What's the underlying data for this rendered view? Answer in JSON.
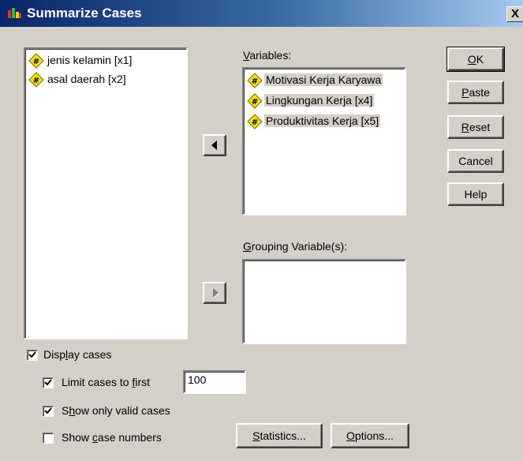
{
  "window": {
    "title": "Summarize Cases",
    "close_label": "X"
  },
  "source_list": {
    "items": [
      {
        "label": "jenis kelamin [x1]",
        "icon": "scale-variable-icon"
      },
      {
        "label": "asal daerah [x2]",
        "icon": "scale-variable-icon"
      }
    ]
  },
  "variables": {
    "label_pre": "",
    "label_key": "V",
    "label_post": "ariables:",
    "items": [
      {
        "label": "Motivasi Kerja Karyawa",
        "icon": "scale-variable-icon"
      },
      {
        "label": "Lingkungan Kerja [x4]",
        "icon": "scale-variable-icon"
      },
      {
        "label": "Produktivitas Kerja [x5]",
        "icon": "scale-variable-icon"
      }
    ]
  },
  "grouping": {
    "label_pre": "",
    "label_key": "G",
    "label_post": "rouping Variable(s):"
  },
  "buttons": {
    "ok": {
      "pre": "",
      "key": "O",
      "post": "K"
    },
    "paste": {
      "pre": "",
      "key": "P",
      "post": "aste"
    },
    "reset": {
      "pre": "",
      "key": "R",
      "post": "eset"
    },
    "cancel": {
      "label": "Cancel"
    },
    "help": {
      "label": "Help"
    },
    "statistics": {
      "pre": "",
      "key": "S",
      "post": "tatistics..."
    },
    "options": {
      "pre": "",
      "key": "O",
      "post": "ptions..."
    }
  },
  "options": {
    "display_cases": {
      "pre": "Disp",
      "key": "l",
      "post": "ay cases",
      "checked": true
    },
    "limit_cases": {
      "pre": "Limit cases to ",
      "key": "f",
      "post": "irst",
      "checked": true,
      "value": "100"
    },
    "valid_cases": {
      "pre": "S",
      "key": "h",
      "post": "ow only valid cases",
      "checked": true
    },
    "case_numbers": {
      "pre": "Show ",
      "key": "c",
      "post": "ase numbers",
      "checked": false
    }
  },
  "colors": {
    "face": "#d4d0c8",
    "title_start": "#0a246a",
    "title_end": "#a6caf0"
  }
}
